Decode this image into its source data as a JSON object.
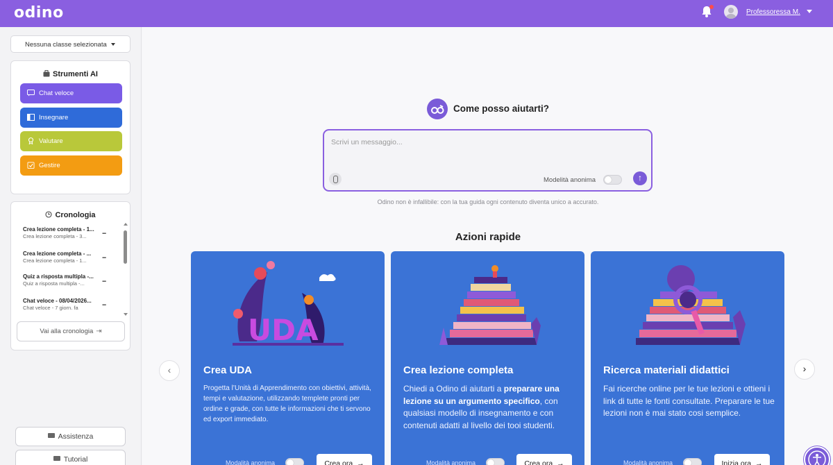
{
  "header": {
    "logo": "odino",
    "user_name": "Professoressa M."
  },
  "sidebar": {
    "class_select": "Nessuna classe selezionata",
    "tools": {
      "title": "Strumenti AI",
      "items": [
        {
          "label": "Chat veloce",
          "color": "#7a5be6"
        },
        {
          "label": "Insegnare",
          "color": "#2f6bd9"
        },
        {
          "label": "Valutare",
          "color": "#b9c83a"
        },
        {
          "label": "Gestire",
          "color": "#f39c12"
        }
      ]
    },
    "history": {
      "title": "Cronologia",
      "items": [
        {
          "title": "Crea lezione completa - 1...",
          "subtitle": "Crea lezione completa - 3..."
        },
        {
          "title": "Crea lezione completa - ...",
          "subtitle": "Crea lezione completa - 1..."
        },
        {
          "title": "Quiz a risposta multipla -...",
          "subtitle": "Quiz a risposta multipla -..."
        },
        {
          "title": "Chat veloce - 08/04/2026...",
          "subtitle": "Chat veloce - 7 giorn. fa"
        }
      ],
      "more_label": "...",
      "button_label": "Vai alla cronologia"
    },
    "bottom": {
      "support_label": "Assistenza",
      "tutorial_label": "Tutorial"
    }
  },
  "main": {
    "prompt_title": "Come posso aiutarti?",
    "chat": {
      "placeholder": "Scrivi un messaggio...",
      "anon_label": "Modelità anonima",
      "send_symbol": "↑"
    },
    "disclaimer": "Odino non è infallibile: con la tua guida ogni contenuto diventa unico a accurato.",
    "quick_actions_title": "Azioni rapide",
    "cards": [
      {
        "title": "Crea UDA",
        "description": "Progetta l’Unità di Apprendimento con obiettivi, attività, tempi e valutazione, utilizzando templete pronti per ordine e grade, con tutte le informazioni che ti servono ed export immediato.",
        "illustration_text": "UDA",
        "anon_label": "Modalità anonima",
        "cta_label": "Crea ora"
      },
      {
        "title": "Crea lezione completa",
        "description_parts": [
          "Chiedi a Odino di aiutarti a ",
          "preparare una lezione su un argumento specifico",
          ", con qualsiasi modello di insegnamento e con contenuti adatti al livello dei tooi studenti."
        ],
        "anon_label": "Modalità anonima",
        "cta_label": "Crea ora"
      },
      {
        "title": "Ricerca materiali didattici",
        "description": "Fai ricerche online per le tue lezioni e ottieni i link di tutte le fonti consultate. Preparare le tue lezioni non è mai stato cosi semplice.",
        "anon_label": "Modalità anonima",
        "cta_label": "Inizia ora"
      }
    ]
  },
  "colors": {
    "brand": "#8a5fe0",
    "card_blue": "#3b73d6"
  }
}
